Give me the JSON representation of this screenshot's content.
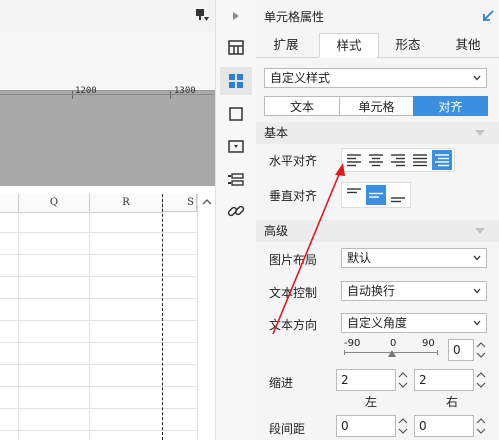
{
  "canvas": {
    "ruler_labels": [
      "1200",
      "1300"
    ],
    "columns": [
      "Q",
      "R",
      "S"
    ]
  },
  "panel": {
    "title": "单元格属性",
    "tabs": [
      {
        "label": "扩展",
        "active": false
      },
      {
        "label": "样式",
        "active": true
      },
      {
        "label": "形态",
        "active": false
      },
      {
        "label": "其他",
        "active": false
      }
    ],
    "style_select": "自定义样式",
    "segments": [
      {
        "label": "文本",
        "active": false
      },
      {
        "label": "单元格",
        "active": false
      },
      {
        "label": "对齐",
        "active": true
      }
    ],
    "basic": {
      "header": "基本",
      "h_align_label": "水平对齐",
      "v_align_label": "垂直对齐",
      "h_align_selected": "distributed",
      "v_align_selected": "middle"
    },
    "advanced": {
      "header": "高级",
      "image_layout_label": "图片布局",
      "image_layout_value": "默认",
      "text_control_label": "文本控制",
      "text_control_value": "自动换行",
      "text_direction_label": "文本方向",
      "text_direction_value": "自定义角度",
      "angle_min": "-90",
      "angle_mid": "0",
      "angle_max": "90",
      "angle_value": "0",
      "indent_label": "缩进",
      "indent_left_value": "2",
      "indent_right_value": "2",
      "indent_left_caption": "左",
      "indent_right_caption": "右",
      "paragraph_spacing_label": "段间距",
      "para_before_value": "0",
      "para_after_value": "0"
    }
  },
  "accent_color": "#3b8fe0",
  "arrow_color": "#e0191b"
}
